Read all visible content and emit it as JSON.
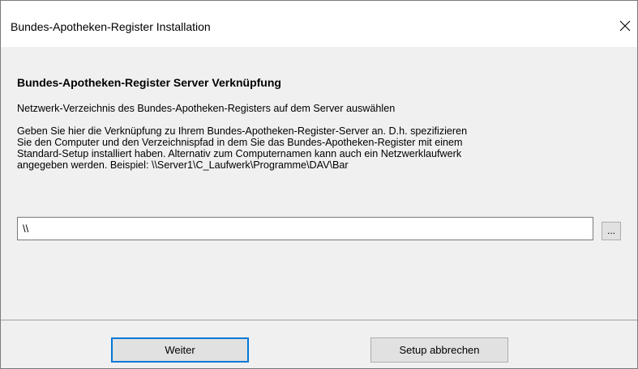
{
  "window": {
    "title": "Bundes-Apotheken-Register Installation",
    "close_icon": "close-icon"
  },
  "main": {
    "heading": "Bundes-Apotheken-Register Server Verknüpfung",
    "subheading": "Netzwerk-Verzeichnis des Bundes-Apotheken-Registers auf dem Server auswählen",
    "description_lines": [
      "Geben Sie hier die Verknüpfung zu Ihrem Bundes-Apotheken-Register-Server an. D.h. spezifizieren",
      "Sie den Computer und den Verzeichnispfad in dem Sie das Bundes-Apotheken-Register mit einem",
      "Standard-Setup installiert haben. Alternativ zum Computernamen kann auch ein Netzwerklaufwerk",
      "angegeben werden. Beispiel: \\\\Server1\\C_Laufwerk\\Programme\\DAV\\Bar"
    ],
    "path_value": "\\\\",
    "browse_label": "..."
  },
  "footer": {
    "next_label": "Weiter",
    "cancel_label": "Setup abbrechen"
  },
  "colors": {
    "default_button_border": "#0078d7",
    "dialog_background": "#f0f0f0",
    "title_background": "#ffffff"
  }
}
